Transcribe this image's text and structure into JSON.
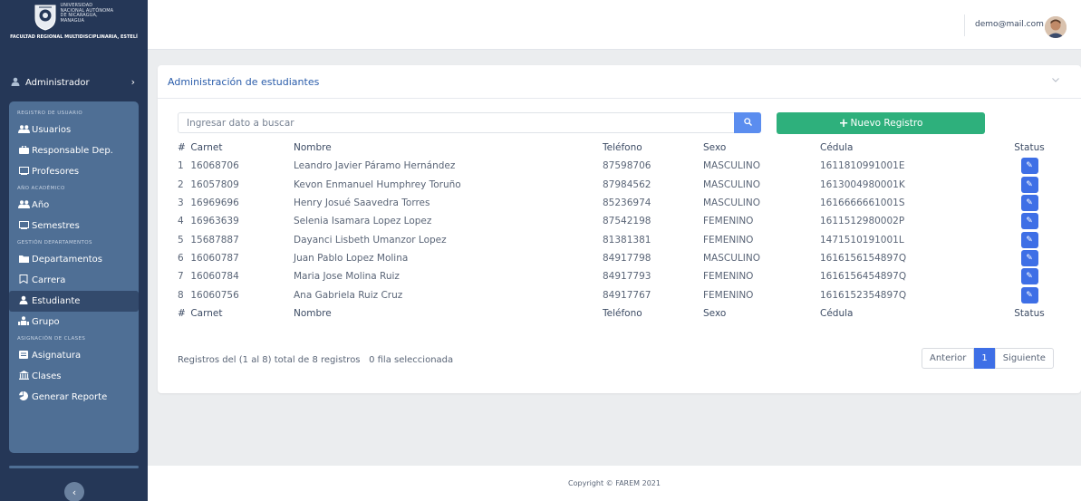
{
  "brand": {
    "university": "UNIVERSIDAD NACIONAL AUTÓNOMA DE NICARAGUA, MANAGUA",
    "motto": "UNAN-MANAGUA",
    "faculty": "FACULTAD REGIONAL MULTIDISCIPLINARIA, ESTELÍ"
  },
  "sidebar": {
    "admin_label": "Administrador",
    "sections": {
      "registro": "REGISTRO DE USUARIO",
      "anio": "AÑO ACADÉMICO",
      "gestion": "GESTIÓN DEPARTAMENTOS",
      "asignacion": "ASIGNACIÓN DE CLASES"
    },
    "items": {
      "usuarios": "Usuarios",
      "responsable": "Responsable Dep.",
      "profesores": "Profesores",
      "anio": "Año",
      "semestres": "Semestres",
      "departamentos": "Departamentos",
      "carrera": "Carrera",
      "estudiante": "Estudiante",
      "grupo": "Grupo",
      "asignatura": "Asignatura",
      "clases": "Clases",
      "reporte": "Generar Reporte"
    },
    "active": "estudiante"
  },
  "header": {
    "user_email": "demo@mail.com"
  },
  "card": {
    "title": "Administración de estudiantes",
    "search_placeholder": "Ingresar dato a buscar",
    "new_button": "Nuevo Registro"
  },
  "table": {
    "columns": {
      "num": "#",
      "carnet": "Carnet",
      "nombre": "Nombre",
      "telefono": "Teléfono",
      "sexo": "Sexo",
      "cedula": "Cédula",
      "status": "Status"
    },
    "rows": [
      {
        "num": "1",
        "carnet": "16068706",
        "nombre": "Leandro Javier Páramo Hernández",
        "telefono": "87598706",
        "sexo": "MASCULINO",
        "cedula": "1611810991001E"
      },
      {
        "num": "2",
        "carnet": "16057809",
        "nombre": "Kevon Enmanuel Humphrey Toruño",
        "telefono": "87984562",
        "sexo": "MASCULINO",
        "cedula": "1613004980001K"
      },
      {
        "num": "3",
        "carnet": "16969696",
        "nombre": "Henry Josué Saavedra Torres",
        "telefono": "85236974",
        "sexo": "MASCULINO",
        "cedula": "1616666661001S"
      },
      {
        "num": "4",
        "carnet": "16963639",
        "nombre": "Selenia Isamara Lopez Lopez",
        "telefono": "87542198",
        "sexo": "FEMENINO",
        "cedula": "1611512980002P"
      },
      {
        "num": "5",
        "carnet": "15687887",
        "nombre": "Dayanci Lisbeth Umanzor Lopez",
        "telefono": "81381381",
        "sexo": "FEMENINO",
        "cedula": "1471510191001L"
      },
      {
        "num": "6",
        "carnet": "16060787",
        "nombre": "Juan Pablo Lopez Molina",
        "telefono": "84917798",
        "sexo": "MASCULINO",
        "cedula": "1616156154897Q"
      },
      {
        "num": "7",
        "carnet": "16060784",
        "nombre": "Maria Jose Molina Ruiz",
        "telefono": "84917793",
        "sexo": "FEMENINO",
        "cedula": "1616156454897Q"
      },
      {
        "num": "8",
        "carnet": "16060756",
        "nombre": "Ana Gabriela Ruiz Cruz",
        "telefono": "84917767",
        "sexo": "FEMENINO",
        "cedula": "1616152354897Q"
      }
    ]
  },
  "info": {
    "records": "Registros del (1 al 8) total de 8 registros",
    "selected": "0 fila seleccionada"
  },
  "pager": {
    "prev": "Anterior",
    "current": "1",
    "next": "Siguiente"
  },
  "footer": {
    "copyright": "Copyright © FAREM 2021"
  },
  "colors": {
    "sidebar_bg": "#253757",
    "menu_panel": "#4f6f95",
    "primary": "#3e6fe6",
    "success": "#2eb07c",
    "title": "#2a5caa"
  },
  "icons": {
    "search": "search-icon",
    "plus": "plus-icon",
    "edit": "edit-icon"
  }
}
